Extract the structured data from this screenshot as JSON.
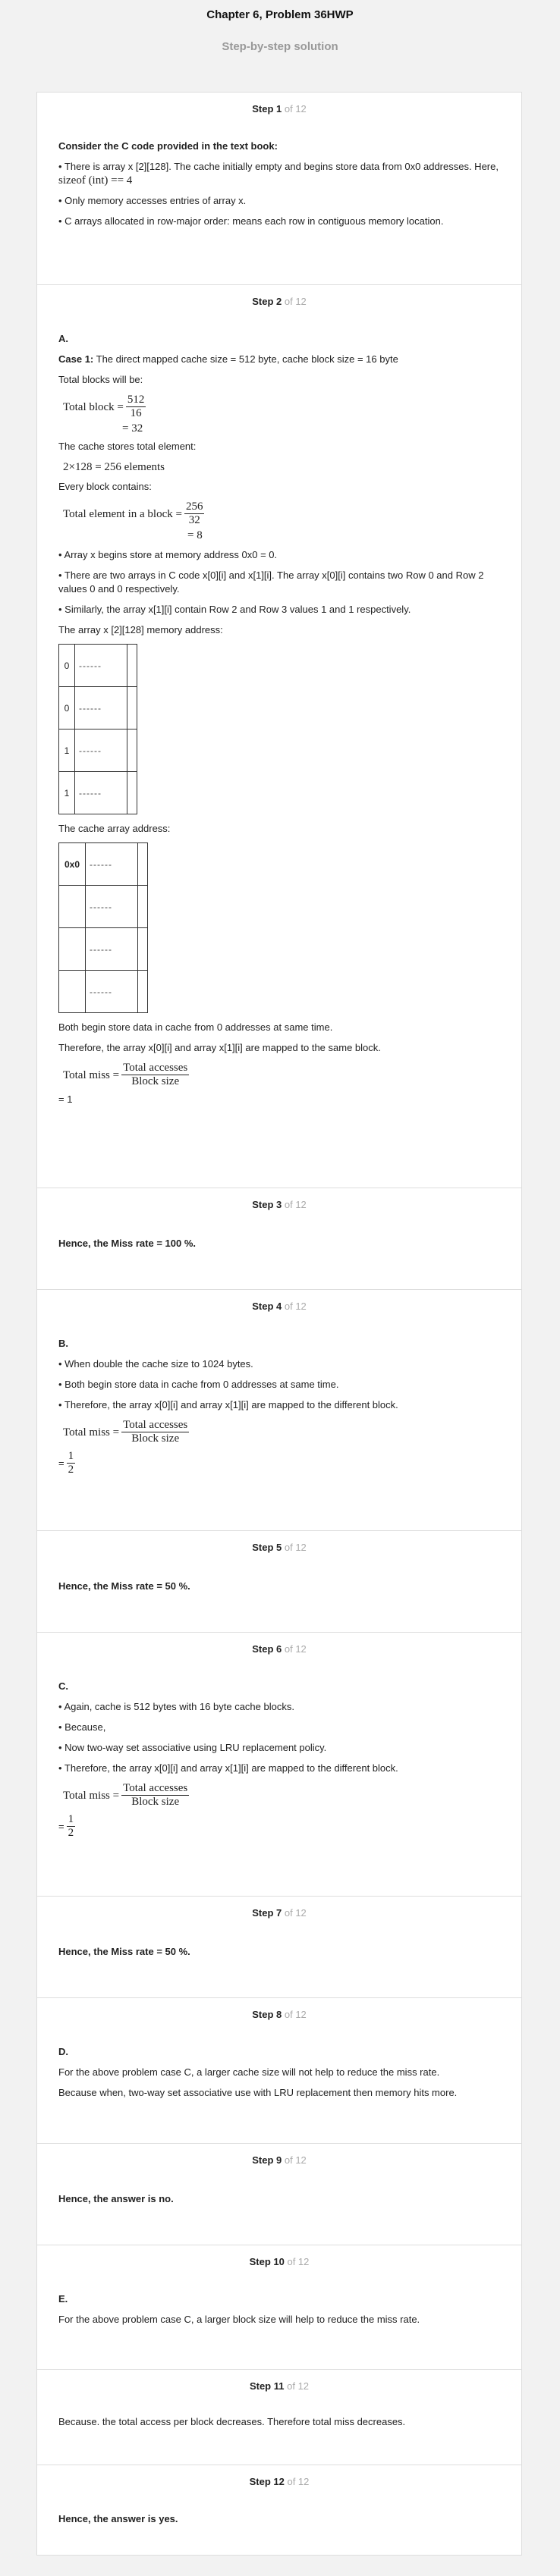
{
  "header": {
    "title": "Chapter 6, Problem 36HWP",
    "subtitle": "Step-by-step solution"
  },
  "steps": [
    {
      "label": "Step 1",
      "of": "of 12"
    },
    {
      "label": "Step 2",
      "of": "of 12"
    },
    {
      "label": "Step 3",
      "of": "of 12"
    },
    {
      "label": "Step 4",
      "of": "of 12"
    },
    {
      "label": "Step 5",
      "of": "of 12"
    },
    {
      "label": "Step 6",
      "of": "of 12"
    },
    {
      "label": "Step 7",
      "of": "of 12"
    },
    {
      "label": "Step 8",
      "of": "of 12"
    },
    {
      "label": "Step 9",
      "of": "of 12"
    },
    {
      "label": "Step 10",
      "of": "of 12"
    },
    {
      "label": "Step 11",
      "of": "of 12"
    },
    {
      "label": "Step 12",
      "of": "of 12"
    }
  ],
  "s1": {
    "heading": "Consider the C code provided in the text book:",
    "b1": "• There is array x [2][128]. The cache initially empty and begins store data from 0x0 addresses. Here, ",
    "b1_math": "sizeof (int) == 4",
    "b2": "• Only memory accesses entries of array x.",
    "b3": "• C arrays allocated in row-major order: means each row in contiguous memory location."
  },
  "s2": {
    "sec": "A.",
    "case_label": "Case 1:",
    "case_text": " The direct mapped cache size = 512 byte, cache block size = 16 byte",
    "p1": "Total blocks will be:",
    "tb_lhs": "Total block =",
    "tb_num": "512",
    "tb_den": "16",
    "tb_res": "= 32",
    "p2": "The cache stores total element:",
    "elem_eq": "2×128 = 256 elements",
    "p3": "Every block contains:",
    "te_lhs": "Total element in a block =",
    "te_num": "256",
    "te_den": "32",
    "te_res": "= 8",
    "b1": "• Array x begins store at memory address 0x0 = 0.",
    "b2": "• There are two arrays in C code x[0][i] and x[1][i]. The array x[0][i] contains two Row 0 and Row 2 values 0 and 0 respectively.",
    "b3": "• Similarly, the array x[1][i] contain Row 2 and Row 3 values 1 and 1 respectively.",
    "p4": "The array x [2][128] memory address:",
    "mem_rows": [
      "0",
      "0",
      "1",
      "1"
    ],
    "mem_dash": "------",
    "p5": "The cache array address:",
    "cache_first": "0x0",
    "cache_dash": "------",
    "p6": "Both begin store data in cache from 0 addresses at same time.",
    "p7": "Therefore, the array x[0][i] and array x[1][i] are mapped to the same block.",
    "tm_lhs": "Total miss =",
    "tm_num": "Total accesses",
    "tm_den": "Block size",
    "result": "= 1"
  },
  "s3": {
    "text": "Hence, the Miss rate = 100 %."
  },
  "s4": {
    "sec": "B.",
    "b1": "• When double the cache size to 1024 bytes.",
    "b2": "• Both begin store data in cache from 0 addresses at same time.",
    "b3": "• Therefore, the array x[0][i] and array x[1][i] are mapped to the different block.",
    "tm_lhs": "Total miss =",
    "tm_num": "Total accesses",
    "tm_den": "Block size",
    "eq": "=",
    "r_num": "1",
    "r_den": "2"
  },
  "s5": {
    "text": "Hence, the Miss rate = 50 %."
  },
  "s6": {
    "sec": "C.",
    "b1": "• Again, cache is 512 bytes with 16 byte cache blocks.",
    "b2": "• Because,",
    "b3": "• Now two-way set associative using LRU replacement policy.",
    "b4": "• Therefore, the array x[0][i] and array x[1][i] are mapped to the different block.",
    "tm_lhs": "Total miss =",
    "tm_num": "Total accesses",
    "tm_den": "Block size",
    "eq": "=",
    "r_num": "1",
    "r_den": "2"
  },
  "s7": {
    "text": "Hence, the Miss rate = 50 %."
  },
  "s8": {
    "sec": "D.",
    "p1": "For the above problem case C, a larger cache size will not help to reduce the miss rate.",
    "p2": "Because when, two-way set associative use with LRU replacement then memory hits more."
  },
  "s9": {
    "text": "Hence, the answer is no."
  },
  "s10": {
    "sec": "E.",
    "p1": "For the above problem case C, a larger block size will help to reduce the miss rate."
  },
  "s11": {
    "p1": "Because. the total access per block decreases. Therefore total miss decreases."
  },
  "s12": {
    "text": "Hence, the answer is yes."
  }
}
